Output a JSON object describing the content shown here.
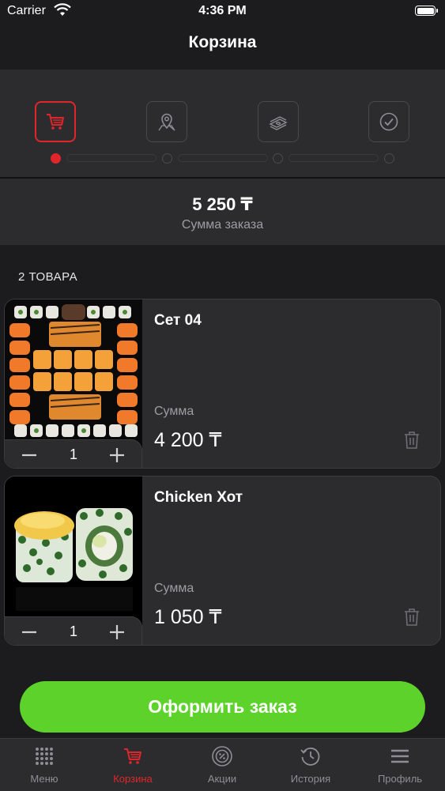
{
  "status_bar": {
    "carrier": "Carrier",
    "time": "4:36 PM"
  },
  "header": {
    "title": "Корзина"
  },
  "checkout_steps": {
    "active_step": 1,
    "steps": [
      {
        "icon": "cart-icon"
      },
      {
        "icon": "location-pin-icon"
      },
      {
        "icon": "cash-icon"
      },
      {
        "icon": "checkmark-icon"
      }
    ]
  },
  "summary": {
    "amount": "5 250 ₸",
    "label": "Сумма заказа"
  },
  "items_count": "2 ТОВАРА",
  "cart_items": [
    {
      "name": "Сет 04",
      "sum_label": "Сумма",
      "price": "4 200 ₸",
      "quantity": "1"
    },
    {
      "name": "Chicken Хот",
      "sum_label": "Сумма",
      "price": "1 050 ₸",
      "quantity": "1"
    }
  ],
  "checkout_button": {
    "label": "Оформить заказ"
  },
  "tab_bar": {
    "active": "Корзина",
    "tabs": [
      {
        "label": "Меню",
        "icon": "menu-grid-icon"
      },
      {
        "label": "Корзина",
        "icon": "cart-icon"
      },
      {
        "label": "Акции",
        "icon": "percent-badge-icon"
      },
      {
        "label": "История",
        "icon": "history-clock-icon"
      },
      {
        "label": "Профиль",
        "icon": "hamburger-icon"
      }
    ]
  },
  "colors": {
    "accent": "#e0262b",
    "button": "#5cd22a",
    "background": "#1c1c1e",
    "panel": "#2c2c2e"
  }
}
